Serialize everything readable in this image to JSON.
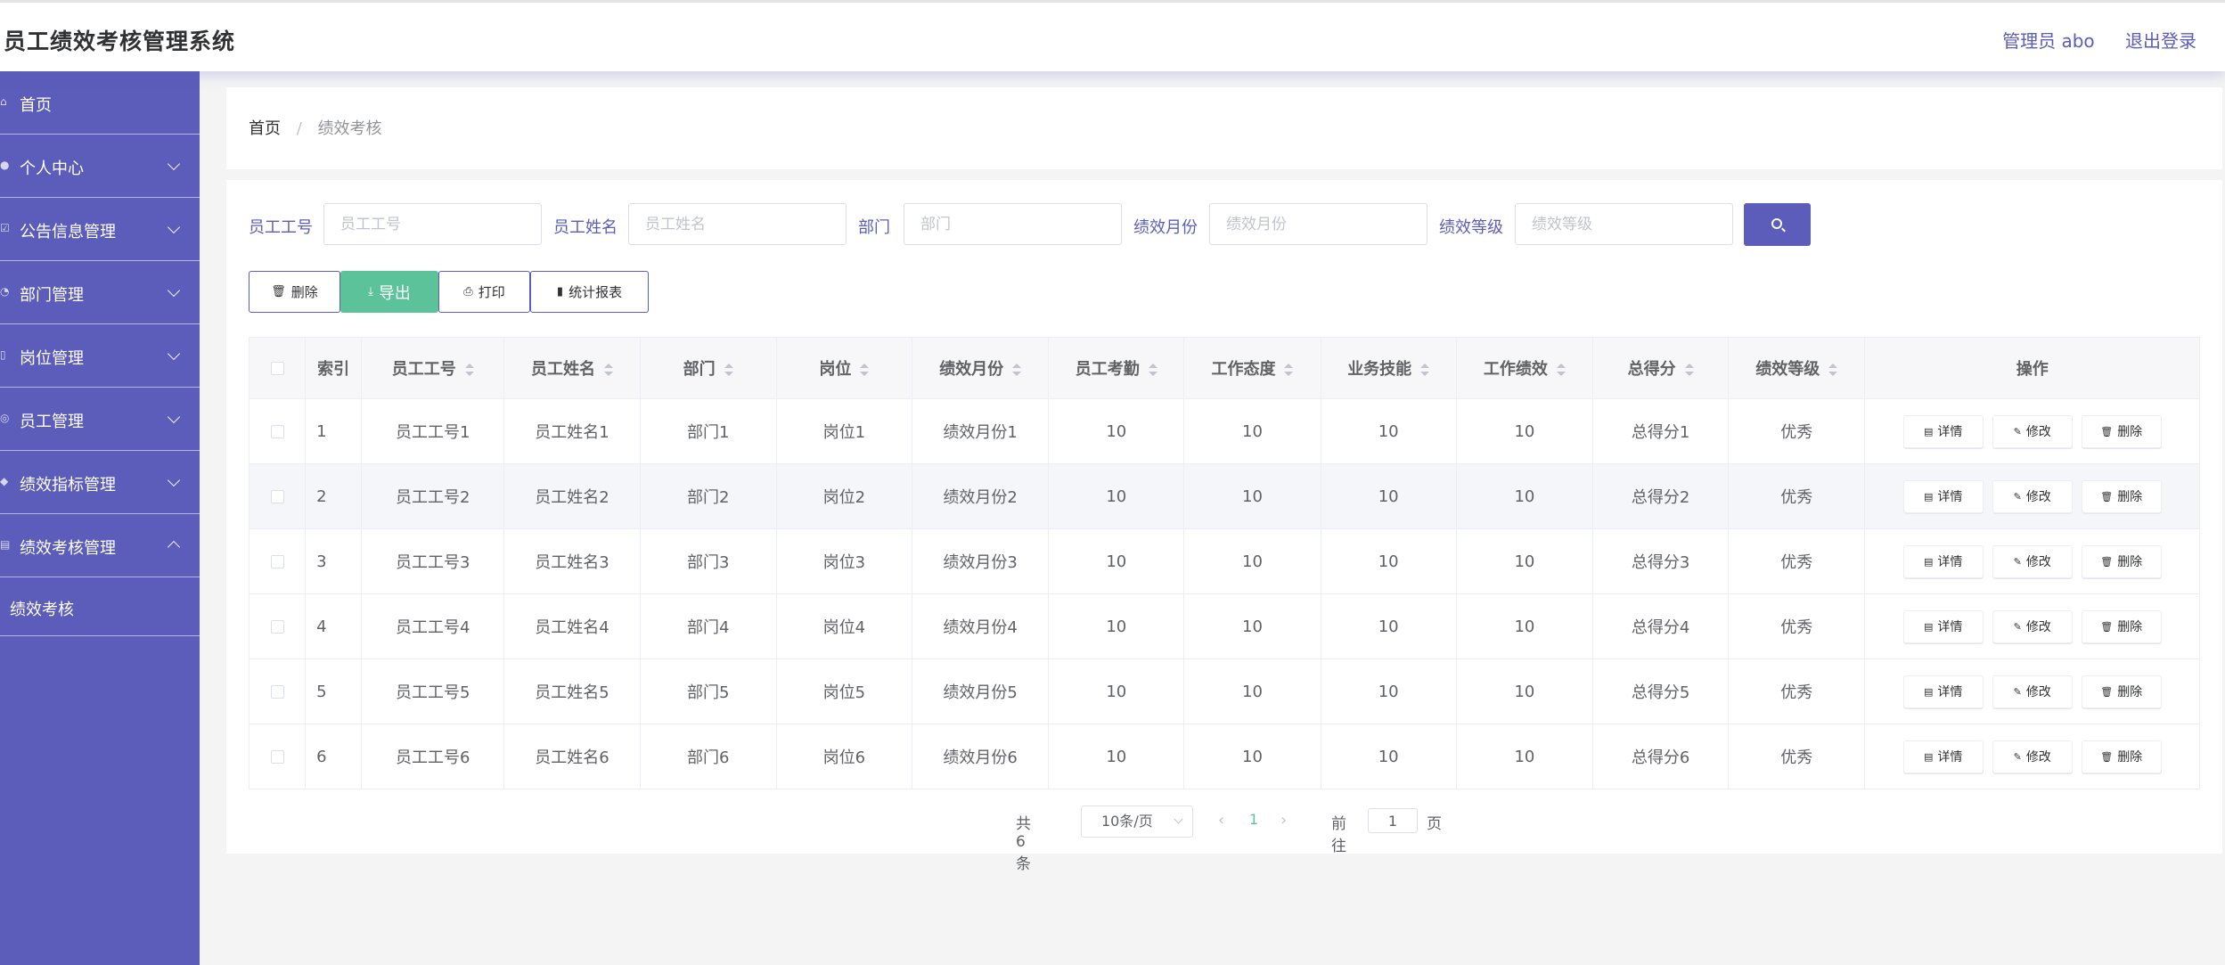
{
  "header": {
    "title": "员工绩效考核管理系统",
    "admin_label": "管理员 abo",
    "logout_label": "退出登录"
  },
  "sidebar": {
    "items": [
      {
        "label": "首页",
        "icon": "home-icon"
      },
      {
        "label": "个人中心",
        "icon": "user-icon"
      },
      {
        "label": "公告信息管理",
        "icon": "notice-icon"
      },
      {
        "label": "部门管理",
        "icon": "department-icon"
      },
      {
        "label": "岗位管理",
        "icon": "position-icon"
      },
      {
        "label": "员工管理",
        "icon": "employee-icon"
      },
      {
        "label": "绩效指标管理",
        "icon": "indicator-icon"
      },
      {
        "label": "绩效考核管理",
        "icon": "assessment-icon"
      }
    ],
    "sub_item": "绩效考核"
  },
  "breadcrumb": {
    "home": "首页",
    "separator": "/",
    "current": "绩效考核"
  },
  "search": {
    "fields": [
      {
        "label": "员工工号",
        "placeholder": "员工工号"
      },
      {
        "label": "员工姓名",
        "placeholder": "员工姓名"
      },
      {
        "label": "部门",
        "placeholder": "部门"
      },
      {
        "label": "绩效月份",
        "placeholder": "绩效月份"
      },
      {
        "label": "绩效等级",
        "placeholder": "绩效等级"
      }
    ]
  },
  "toolbar": {
    "delete": "删除",
    "export": "导出",
    "print": "打印",
    "report": "统计报表"
  },
  "table": {
    "headers": [
      "索引",
      "员工工号",
      "员工姓名",
      "部门",
      "岗位",
      "绩效月份",
      "员工考勤",
      "工作态度",
      "业务技能",
      "工作绩效",
      "总得分",
      "绩效等级",
      "操作"
    ],
    "rows": [
      [
        "1",
        "员工工号1",
        "员工姓名1",
        "部门1",
        "岗位1",
        "绩效月份1",
        "10",
        "10",
        "10",
        "10",
        "总得分1",
        "优秀"
      ],
      [
        "2",
        "员工工号2",
        "员工姓名2",
        "部门2",
        "岗位2",
        "绩效月份2",
        "10",
        "10",
        "10",
        "10",
        "总得分2",
        "优秀"
      ],
      [
        "3",
        "员工工号3",
        "员工姓名3",
        "部门3",
        "岗位3",
        "绩效月份3",
        "10",
        "10",
        "10",
        "10",
        "总得分3",
        "优秀"
      ],
      [
        "4",
        "员工工号4",
        "员工姓名4",
        "部门4",
        "岗位4",
        "绩效月份4",
        "10",
        "10",
        "10",
        "10",
        "总得分4",
        "优秀"
      ],
      [
        "5",
        "员工工号5",
        "员工姓名5",
        "部门5",
        "岗位5",
        "绩效月份5",
        "10",
        "10",
        "10",
        "10",
        "总得分5",
        "优秀"
      ],
      [
        "6",
        "员工工号6",
        "员工姓名6",
        "部门6",
        "岗位6",
        "绩效月份6",
        "10",
        "10",
        "10",
        "10",
        "总得分6",
        "优秀"
      ]
    ],
    "actions": {
      "detail": "详情",
      "edit": "修改",
      "delete": "删除"
    }
  },
  "pagination": {
    "total": "共 6 条",
    "page_size": "10条/页",
    "current_page": "1",
    "goto_prefix": "前往",
    "goto_value": "1",
    "goto_suffix": "页"
  },
  "colors": {
    "primary": "#5c5cba",
    "success": "#5cc29a"
  }
}
